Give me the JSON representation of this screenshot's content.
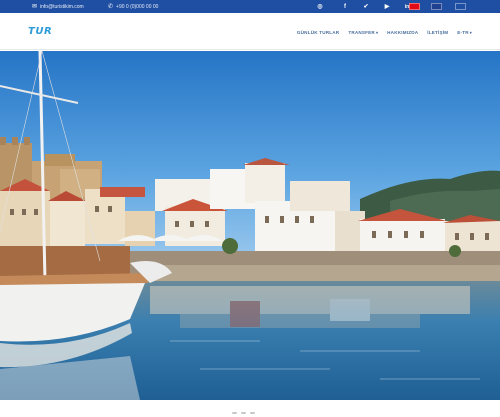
{
  "topbar": {
    "email": "info@turistikim.com",
    "phone": "+90 0 (0)000 00 00",
    "email_icon": "envelope-icon",
    "phone_icon": "phone-icon",
    "social": [
      {
        "icon": "instagram-icon",
        "glyph": "◎"
      },
      {
        "icon": "facebook-icon",
        "glyph": "f"
      },
      {
        "icon": "twitter-icon",
        "glyph": "✔"
      },
      {
        "icon": "youtube-icon",
        "glyph": "▶"
      },
      {
        "icon": "linkedin-icon",
        "glyph": "in"
      }
    ],
    "languages": [
      "turkish-flag-icon",
      "uk-flag-icon",
      "russian-flag-icon"
    ],
    "bar_color": "#1f4fa3"
  },
  "header": {
    "logo": "TUR",
    "nav": [
      {
        "label": "GÜNLÜK TURLAR",
        "dropdown": false
      },
      {
        "label": "TRANSFER",
        "dropdown": true
      },
      {
        "label": "HAKKIMIZDA",
        "dropdown": false
      },
      {
        "label": "İLETİŞİM",
        "dropdown": false
      },
      {
        "label": "E-TR",
        "dropdown": true
      }
    ]
  },
  "hero": {
    "image": "marmaris-harbor-photo"
  },
  "colors": {
    "brand": "#2e9cd6",
    "nav_text": "#4a6f9e",
    "sky": "#2b84d2",
    "sea": "#256e9e"
  }
}
